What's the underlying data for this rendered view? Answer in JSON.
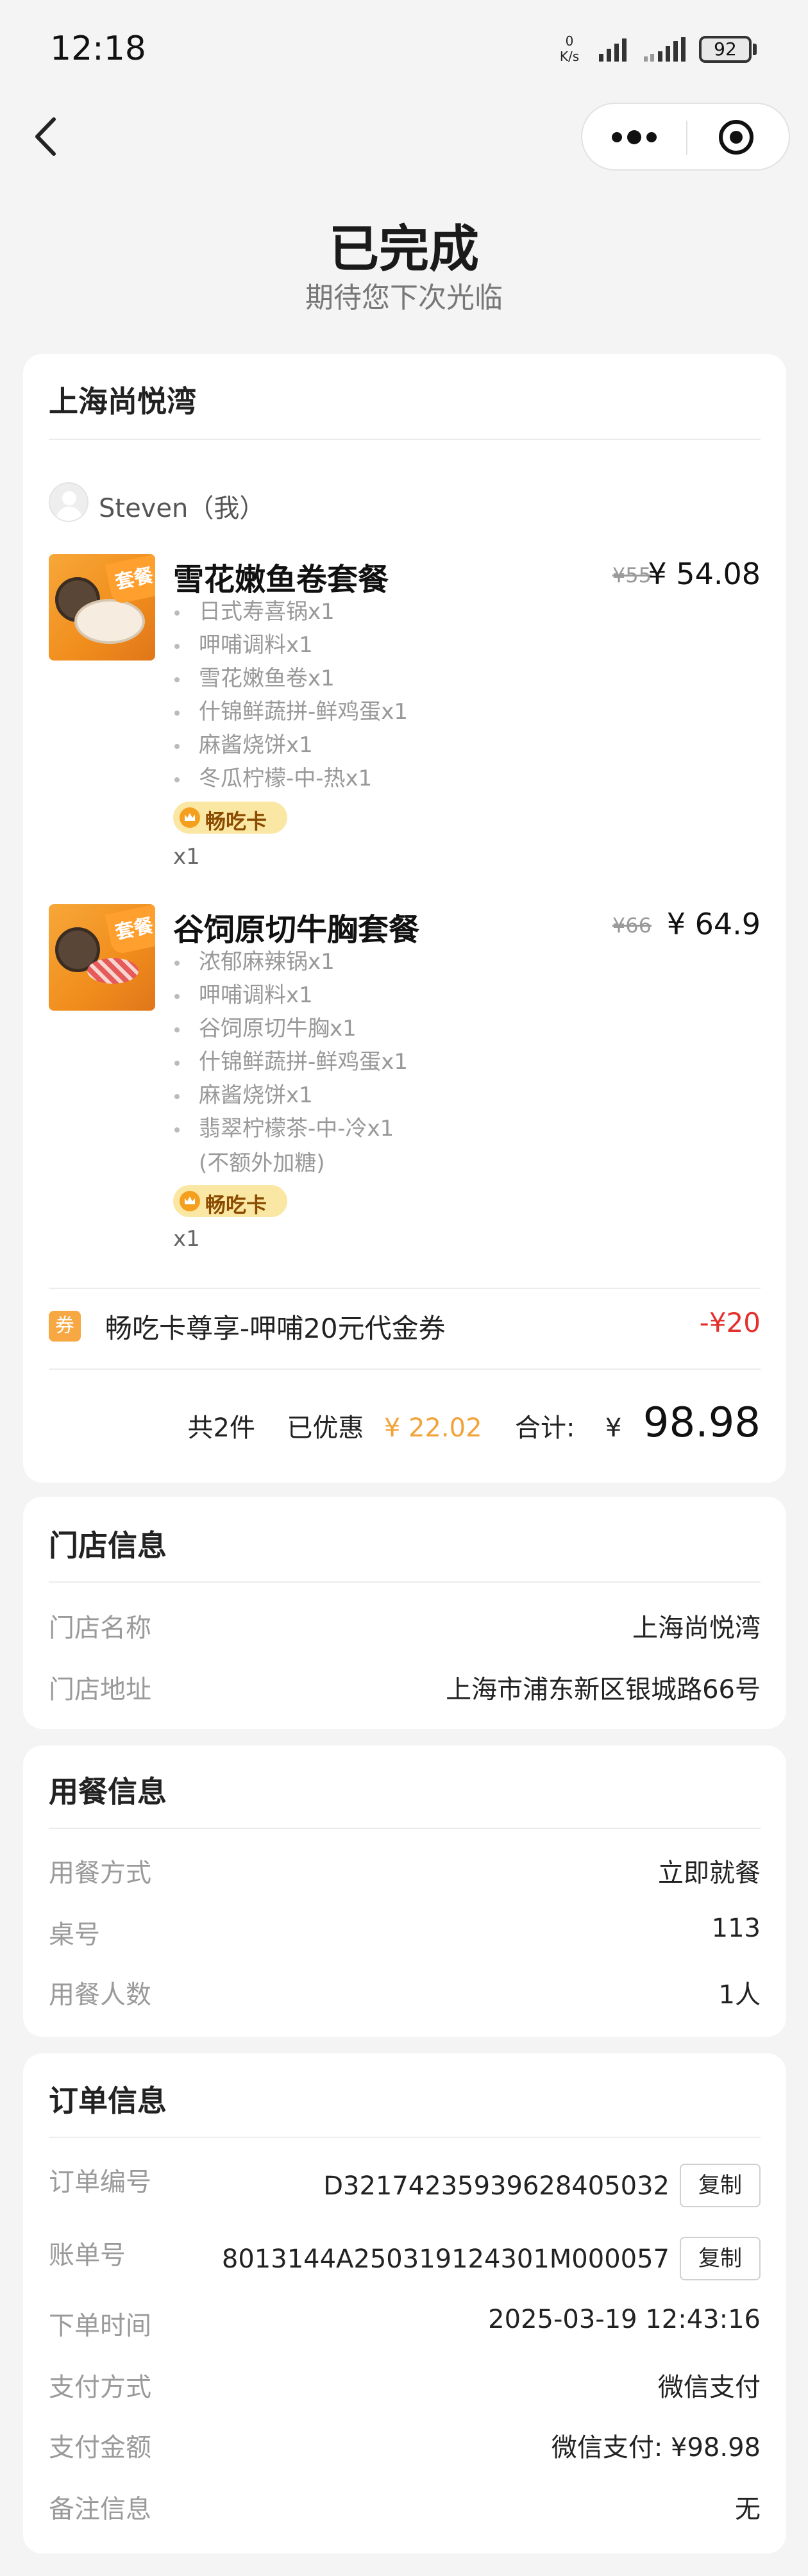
{
  "status_bar": {
    "time": "12:18",
    "net_speed": "0",
    "net_unit": "K/s",
    "battery": "92"
  },
  "page": {
    "status_title": "已完成",
    "status_subtitle": "期待您下次光临"
  },
  "order": {
    "store_name": "上海尚悦湾",
    "user_name": "Steven（我）",
    "items": [
      {
        "name": "雪花嫩鱼卷套餐",
        "old_price": "¥55",
        "price": "¥ 54.08",
        "thumb_tag": "套餐",
        "sub_items": [
          "日式寿喜锅x1",
          "呷哺调料x1",
          "雪花嫩鱼卷x1",
          "什锦鲜蔬拼-鲜鸡蛋x1",
          "麻酱烧饼x1",
          "冬瓜柠檬-中-热x1"
        ],
        "note": "",
        "badge": "畅吃卡",
        "qty": "x1"
      },
      {
        "name": "谷饲原切牛胸套餐",
        "old_price": "¥66",
        "price": "¥ 64.9",
        "thumb_tag": "套餐",
        "sub_items": [
          "浓郁麻辣锅x1",
          "呷哺调料x1",
          "谷饲原切牛胸x1",
          "什锦鲜蔬拼-鲜鸡蛋x1",
          "麻酱烧饼x1",
          "翡翠柠檬茶-中-冷x1"
        ],
        "note": "(不额外加糖)",
        "badge": "畅吃卡",
        "qty": "x1"
      }
    ],
    "coupon": {
      "icon_text": "券",
      "label": "畅吃卡尊享-呷哺20元代金券",
      "amount": "-¥20"
    },
    "summary": {
      "count": "共2件",
      "discount_label": "已优惠",
      "discount": "¥ 22.02",
      "total_label": "合计:",
      "currency": "¥",
      "total": "98.98"
    }
  },
  "store_info": {
    "title": "门店信息",
    "rows": [
      {
        "label": "门店名称",
        "value": "上海尚悦湾"
      },
      {
        "label": "门店地址",
        "value": "上海市浦东新区银城路66号"
      }
    ]
  },
  "dining_info": {
    "title": "用餐信息",
    "rows": [
      {
        "label": "用餐方式",
        "value": "立即就餐"
      },
      {
        "label": "桌号",
        "value": "113"
      },
      {
        "label": "用餐人数",
        "value": "1人"
      }
    ]
  },
  "order_info": {
    "title": "订单信息",
    "copy_label": "复制",
    "rows": [
      {
        "label": "订单编号",
        "value": "D32174235939628405032"
      },
      {
        "label": "账单号",
        "value": "8013144A250319124301M000057"
      },
      {
        "label": "下单时间",
        "value": "2025-03-19 12:43:16"
      },
      {
        "label": "支付方式",
        "value": "微信支付"
      },
      {
        "label": "支付金额",
        "value": "微信支付: ¥98.98"
      },
      {
        "label": "备注信息",
        "value": "无"
      }
    ]
  }
}
